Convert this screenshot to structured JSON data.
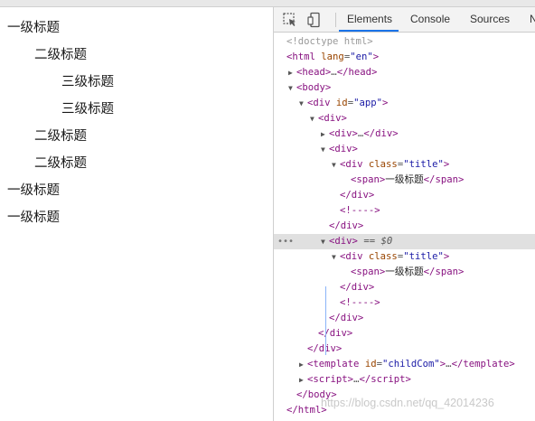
{
  "page": {
    "headings": [
      {
        "text": "一级标题",
        "level": 1
      },
      {
        "text": "二级标题",
        "level": 2
      },
      {
        "text": "三级标题",
        "level": 3
      },
      {
        "text": "三级标题",
        "level": 3
      },
      {
        "text": "二级标题",
        "level": 2
      },
      {
        "text": "二级标题",
        "level": 2
      },
      {
        "text": "一级标题",
        "level": 1
      },
      {
        "text": "一级标题",
        "level": 1
      }
    ]
  },
  "devtools": {
    "tabs": [
      "Elements",
      "Console",
      "Sources",
      "N"
    ],
    "active_tab": "Elements",
    "icons": {
      "inspect": "inspect-element-icon",
      "device": "device-toolbar-icon"
    },
    "selected_suffix": "== $0",
    "tree": [
      {
        "tag": "<!doctype html>",
        "toggle": ""
      },
      {
        "tag": "html",
        "attr": "lang",
        "val": "en",
        "toggle": ""
      },
      {
        "tag": "head",
        "collapsed": "…",
        "close": "head",
        "toggle": "▶"
      },
      {
        "tag": "body",
        "toggle": "▼"
      },
      {
        "tag": "div",
        "attr": "id",
        "val": "app",
        "toggle": "▼"
      },
      {
        "tag": "div",
        "toggle": "▼"
      },
      {
        "tag": "div",
        "collapsed": "…",
        "close": "div",
        "toggle": "▶"
      },
      {
        "tag": "div",
        "toggle": "▼"
      },
      {
        "tag": "div",
        "attr": "class",
        "val": "title",
        "toggle": "▼"
      },
      {
        "tag": "span",
        "text": "一级标题",
        "close": "span"
      },
      {
        "close": "div"
      },
      {
        "comment": "<!---->"
      },
      {
        "close": "div"
      },
      {
        "tag": "div",
        "toggle": "▼",
        "selected": true
      },
      {
        "tag": "div",
        "attr": "class",
        "val": "title",
        "toggle": "▼"
      },
      {
        "tag": "span",
        "text": "一级标题",
        "close": "span"
      },
      {
        "close": "div"
      },
      {
        "comment": "<!---->"
      },
      {
        "close": "div"
      },
      {
        "close": "div"
      },
      {
        "close": "div"
      },
      {
        "tag": "template",
        "attr": "id",
        "val": "childCom",
        "collapsed": "…",
        "close": "template",
        "toggle": "▶"
      },
      {
        "tag": "script",
        "collapsed": "…",
        "close": "script",
        "toggle": "▶"
      },
      {
        "close": "body"
      },
      {
        "close": "html"
      }
    ]
  },
  "watermark": "https://blog.csdn.net/qq_42014236",
  "colors": {
    "tag": "#881280",
    "attr": "#994500",
    "value": "#1a1aa6",
    "accent": "#1a73e8",
    "selected_row": "#e0e0e0"
  }
}
